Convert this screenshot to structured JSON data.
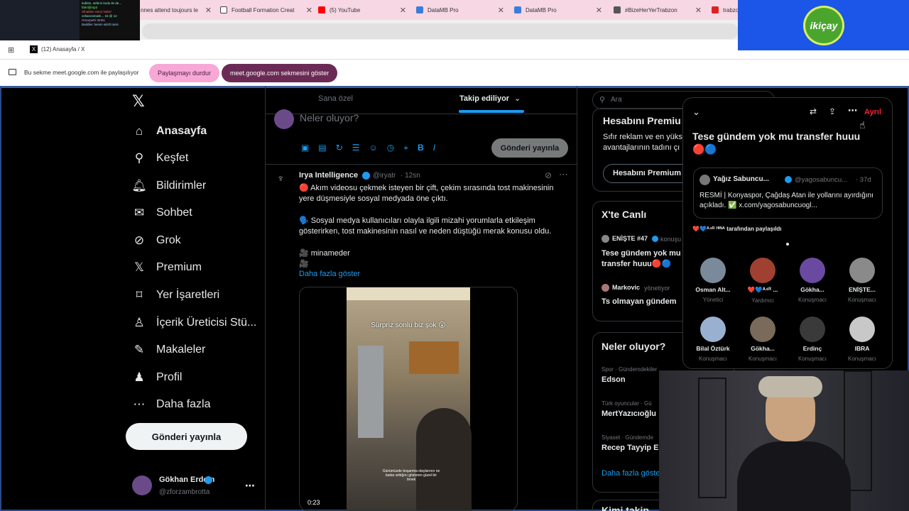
{
  "browser": {
    "tabs": [
      {
        "label": "nnes attend toujours le"
      },
      {
        "label": "Football Formation Creat"
      },
      {
        "label": "(5) YouTube"
      },
      {
        "label": "DataMB Pro"
      },
      {
        "label": "DataMB Pro"
      },
      {
        "label": "#BizeHerYerTrabzon"
      },
      {
        "label": "trabzo"
      }
    ],
    "active_tab": "(12) Anasayfa / X"
  },
  "share_bar": {
    "message": "Bu sekme meet.google.com ile paylaşılıyor",
    "stop_label": "Paylaşmayı durdur",
    "show_label": "meet.google.com sekmesini göster"
  },
  "overlay": {
    "logo_text": "ikiçay",
    "thumb_lines": [
      "indirim, sefer1i kodu ile de...",
      "fahri@mp3",
      "Sfnaitikn sinon haber",
      "ozkanzamaslı... 15 @ 12",
      "Omarpetti: BrMs",
      "Baddiie: benim akizli tanis"
    ]
  },
  "nav": {
    "items": [
      {
        "label": "Anasayfa",
        "icon": "home-icon"
      },
      {
        "label": "Keşfet",
        "icon": "search-icon"
      },
      {
        "label": "Bildirimler",
        "icon": "bell-icon"
      },
      {
        "label": "Sohbet",
        "icon": "mail-icon"
      },
      {
        "label": "Grok",
        "icon": "grok-icon"
      },
      {
        "label": "Premium",
        "icon": "x-icon"
      },
      {
        "label": "Yer İşaretleri",
        "icon": "bookmark-icon"
      },
      {
        "label": "İçerik Üreticisi Stü...",
        "icon": "creator-icon"
      },
      {
        "label": "Makaleler",
        "icon": "article-icon"
      },
      {
        "label": "Profil",
        "icon": "person-icon"
      },
      {
        "label": "Daha fazla",
        "icon": "more-circle-icon"
      }
    ],
    "post_label": "Gönderi yayınla",
    "account": {
      "name": "Gökhan Erdem",
      "handle": "@zforzambrotta"
    }
  },
  "feed": {
    "tabs": [
      "Sana özel",
      "Takip ediliyor"
    ],
    "composer_placeholder": "Neler oluyor?",
    "composer_post_label": "Gönderi yayınla",
    "tweet": {
      "author": "Irya Intelligence",
      "handle": "@iryatr",
      "time": "12sn",
      "p1": "🔴 Akım videosu çekmek isteyen bir çift, çekim sırasında tost makinesinin yere düşmesiyle sosyal medyada öne çıktı.",
      "p2": "🗣️ Sosyal medya kullanıcıları olayla ilgili mizahi yorumlarla etkileşim gösterirken, tost makinesinin nasıl ve neden düştüğü merak konusu oldu.",
      "p3": "🎥 minameder",
      "p4": "🎥",
      "more": "Daha fazla göster",
      "video_caption": "Sürpriz sonlu biz şok 😮",
      "video_subtitle": "Günümüzde boşanma olaylarının ne kadar arttığını gösteren güzel bir örnek",
      "video_time": "0:23"
    }
  },
  "right": {
    "search_placeholder": "Ara",
    "premium_title": "Hesabını Premiu",
    "premium_text": "Sıfır reklam ve en yüks avantajlarının tadını çı",
    "premium_btn": "Hesabını Premium",
    "live_title": "X'te Canlı",
    "live1_user": "ENİŞTE #47",
    "live1_role": "konuşu",
    "live1_title": "Tese gündem yok mu transfer huuu🔴🔵",
    "live2_user": "Markovic",
    "live2_role": "yönetiyor",
    "live2_title": "Ts olmayan gündem",
    "trends_title": "Neler oluyor?",
    "trends": [
      {
        "meta": "Spor · Gündemdekiler",
        "name": "Edson"
      },
      {
        "meta": "Türk oyuncular · Gü",
        "name": "MertYazıcıoğlu"
      },
      {
        "meta": "Siyaset · Gündemde",
        "name": "Recep Tayyip E"
      }
    ],
    "show_more": "Daha fazla göste",
    "who_title": "Kimi takip"
  },
  "space": {
    "leave_label": "Ayrıl",
    "title": "Tese gündem yok mu transfer huuu",
    "emoji": "🔴🔵",
    "pinned_name": "Yağız Sabuncu...",
    "pinned_handle": "@yagosabuncu...",
    "pinned_time": "· 37d",
    "pinned_text": "RESMİ | Konyaspor, Çağdaş Atan ile yollarını ayırdığını açıkladı. ✅ x.com/yagosabuncuogl...",
    "shared_by": "❤️💙ᴬ⁴ᴿ ᴴᴵᴺᴬ tarafından paylaşıldı",
    "speakers": [
      {
        "name": "Osman Alt...",
        "role": "Yönetici"
      },
      {
        "name": "❤️💙ᴬ⁴ᴿ ...",
        "role": "Yardımcı"
      },
      {
        "name": "Gökha...",
        "role": "Konuşmacı"
      },
      {
        "name": "ENİŞTE...",
        "role": "Konuşmacı"
      },
      {
        "name": "Bilal Öztürk",
        "role": "Konuşmacı"
      },
      {
        "name": "Gökha...",
        "role": "Konuşmacı"
      },
      {
        "name": "Erdinç",
        "role": "Konuşmacı"
      },
      {
        "name": "IBRA",
        "role": "Konuşmacı"
      }
    ]
  },
  "colors": {
    "accent": "#1d9bf0",
    "leave": "#f4212e",
    "share_pink": "#f7a8d6",
    "share_purple": "#6b2a56"
  }
}
